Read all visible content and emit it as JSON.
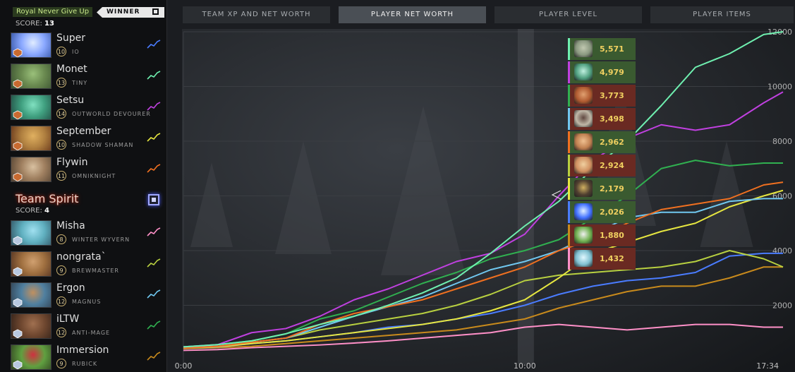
{
  "team1": {
    "name": "Royal Never Give Up",
    "winner_label": "WINNER",
    "score_label": "SCORE:",
    "score": "13",
    "players": [
      {
        "name": "Super",
        "level": "10",
        "hero": "IO",
        "color": "#4a7cff",
        "portrait": [
          "#8aa8ff",
          "#e0ecff",
          "#3050a0"
        ]
      },
      {
        "name": "Monet",
        "level": "13",
        "hero": "TINY",
        "color": "#6ff0b0",
        "portrait": [
          "#6a8a50",
          "#9ac07a",
          "#3a5030"
        ]
      },
      {
        "name": "Setsu",
        "level": "14",
        "hero": "OUTWORLD DEVOURER",
        "color": "#c040e0",
        "portrait": [
          "#40a080",
          "#80e0c0",
          "#204840"
        ]
      },
      {
        "name": "September",
        "level": "10",
        "hero": "SHADOW SHAMAN",
        "color": "#e6e640",
        "portrait": [
          "#b08040",
          "#e0b060",
          "#603018"
        ]
      },
      {
        "name": "Flywin",
        "level": "11",
        "hero": "OMNIKNIGHT",
        "color": "#f07020",
        "portrait": [
          "#a08060",
          "#d8c0a0",
          "#504030"
        ]
      }
    ]
  },
  "team2": {
    "name": "Team Spirit",
    "score_label": "SCORE:",
    "score": "4",
    "players": [
      {
        "name": "Misha",
        "level": "8",
        "hero": "WINTER WYVERN",
        "color": "#ff90c8",
        "portrait": [
          "#60b0c0",
          "#a0e0f0",
          "#305060"
        ]
      },
      {
        "name": "nongrata`",
        "level": "9",
        "hero": "BREWMASTER",
        "color": "#b8d040",
        "portrait": [
          "#a07040",
          "#d0a070",
          "#503020"
        ]
      },
      {
        "name": "Ergon",
        "level": "12",
        "hero": "MAGNUS",
        "color": "#70c8f0",
        "portrait": [
          "#5080a0",
          "#c09060",
          "#304050"
        ]
      },
      {
        "name": "iLTW",
        "level": "12",
        "hero": "ANTI-MAGE",
        "color": "#30b050",
        "portrait": [
          "#704830",
          "#a07050",
          "#302018"
        ]
      },
      {
        "name": "Immersion",
        "level": "9",
        "hero": "RUBICK",
        "color": "#c88a1c",
        "portrait": [
          "#60a040",
          "#d03040",
          "#304020"
        ]
      }
    ]
  },
  "tabs": [
    {
      "label": "TEAM XP AND NET WORTH",
      "active": false
    },
    {
      "label": "PLAYER NET WORTH",
      "active": true
    },
    {
      "label": "PLAYER LEVEL",
      "active": false
    },
    {
      "label": "PLAYER ITEMS",
      "active": false
    }
  ],
  "chart_data": {
    "type": "line",
    "title": "",
    "xlabel": "",
    "ylabel": "",
    "x_ticks": [
      "0:00",
      "10:00",
      "17:34"
    ],
    "y_ticks": [
      "2000",
      "4000",
      "6000",
      "8000",
      "10000",
      "12000"
    ],
    "ylim": [
      0,
      12000
    ],
    "x_range_seconds": [
      0,
      1054
    ],
    "hover_time_seconds": 600,
    "x_seconds": [
      0,
      60,
      120,
      180,
      240,
      300,
      360,
      420,
      480,
      540,
      600,
      660,
      720,
      780,
      840,
      900,
      960,
      1020,
      1054
    ],
    "series": [
      {
        "hero": "TINY",
        "color": "#6ff0b0",
        "values": [
          480,
          560,
          700,
          960,
          1300,
          1600,
          2000,
          2450,
          3000,
          3900,
          4900,
          5800,
          7000,
          8000,
          9300,
          10700,
          11200,
          11900,
          12000
        ]
      },
      {
        "hero": "OUTWORLD DEVOURER",
        "color": "#c040e0",
        "values": [
          480,
          560,
          1000,
          1150,
          1600,
          2200,
          2600,
          3100,
          3600,
          3900,
          4600,
          6000,
          7300,
          8100,
          8600,
          8400,
          8600,
          9400,
          9800
        ]
      },
      {
        "hero": "ANTI-MAGE",
        "color": "#30b050",
        "values": [
          480,
          560,
          700,
          950,
          1500,
          1800,
          2300,
          2800,
          3200,
          3700,
          4000,
          4400,
          5200,
          6000,
          7000,
          7300,
          7100,
          7200,
          7200
        ]
      },
      {
        "hero": "OMNIKNIGHT",
        "color": "#f07020",
        "values": [
          430,
          500,
          650,
          800,
          1300,
          1700,
          1950,
          2200,
          2600,
          3000,
          3400,
          4000,
          4400,
          5000,
          5500,
          5700,
          5900,
          6400,
          6500
        ]
      },
      {
        "hero": "MAGNUS",
        "color": "#70c8f0",
        "values": [
          450,
          500,
          650,
          800,
          1200,
          1600,
          1950,
          2300,
          2800,
          3300,
          3600,
          4000,
          4600,
          5200,
          5400,
          5400,
          5800,
          5900,
          5900
        ]
      },
      {
        "hero": "SHADOW SHAMAN",
        "color": "#e6e640",
        "values": [
          420,
          480,
          600,
          700,
          850,
          1000,
          1150,
          1300,
          1500,
          1800,
          2200,
          3000,
          3900,
          4300,
          4700,
          5000,
          5600,
          6000,
          6200
        ]
      },
      {
        "hero": "BREWMASTER",
        "color": "#b8d040",
        "values": [
          430,
          480,
          650,
          800,
          1100,
          1300,
          1500,
          1700,
          2000,
          2400,
          2900,
          3100,
          3200,
          3300,
          3400,
          3600,
          4000,
          3700,
          3400
        ]
      },
      {
        "hero": "IO",
        "color": "#4a7cff",
        "values": [
          420,
          470,
          600,
          700,
          850,
          1000,
          1200,
          1300,
          1500,
          1700,
          2000,
          2400,
          2700,
          2900,
          3000,
          3200,
          3800,
          3900,
          3900
        ]
      },
      {
        "hero": "RUBICK",
        "color": "#c88a1c",
        "values": [
          420,
          450,
          500,
          600,
          700,
          800,
          900,
          1000,
          1100,
          1300,
          1500,
          1900,
          2200,
          2500,
          2700,
          2700,
          3000,
          3400,
          3400
        ]
      },
      {
        "hero": "WINTER WYVERN",
        "color": "#ff90c8",
        "values": [
          350,
          380,
          450,
          500,
          550,
          620,
          700,
          800,
          900,
          1000,
          1200,
          1300,
          1200,
          1100,
          1200,
          1300,
          1300,
          1200,
          1200
        ]
      }
    ],
    "tooltip": [
      {
        "value": "5,571",
        "color": "#6ff0b0",
        "icon": "tiny-icon",
        "bg": "#3a5a30",
        "icon_colors": [
          "#8a9880",
          "#c0c8b0"
        ]
      },
      {
        "value": "4,979",
        "color": "#c040e0",
        "icon": "outworld-devourer-icon",
        "bg": "#3a5a30",
        "icon_colors": [
          "#50a080",
          "#c0f0e0"
        ]
      },
      {
        "value": "3,773",
        "color": "#30b050",
        "icon": "anti-mage-icon",
        "bg": "#6a2a22",
        "icon_colors": [
          "#b05a30",
          "#e0a070"
        ]
      },
      {
        "value": "3,498",
        "color": "#70c8f0",
        "icon": "magnus-icon",
        "bg": "#6a2a22",
        "icon_colors": [
          "#c0b8a8",
          "#604840"
        ]
      },
      {
        "value": "2,962",
        "color": "#f07020",
        "icon": "omniknight-icon",
        "bg": "#3a5a30",
        "icon_colors": [
          "#c08050",
          "#f0c090"
        ]
      },
      {
        "value": "2,924",
        "color": "#b8d040",
        "icon": "brewmaster-icon",
        "bg": "#6a2a22",
        "icon_colors": [
          "#d09060",
          "#f0d0a0"
        ]
      },
      {
        "value": "2,179",
        "color": "#e6e640",
        "icon": "shadow-shaman-icon",
        "bg": "#3a5a30",
        "icon_colors": [
          "#504030",
          "#d0b060"
        ]
      },
      {
        "value": "2,026",
        "color": "#4a7cff",
        "icon": "io-icon",
        "bg": "#3a5a30",
        "icon_colors": [
          "#4070ff",
          "#e0f0ff"
        ]
      },
      {
        "value": "1,880",
        "color": "#c88a1c",
        "icon": "rubick-icon",
        "bg": "#6a2a22",
        "icon_colors": [
          "#70b050",
          "#f0f0f0"
        ]
      },
      {
        "value": "1,432",
        "color": "#ff90c8",
        "icon": "winter-wyvern-icon",
        "bg": "#6a2a22",
        "icon_colors": [
          "#80c0d0",
          "#e0f8ff"
        ]
      }
    ]
  }
}
